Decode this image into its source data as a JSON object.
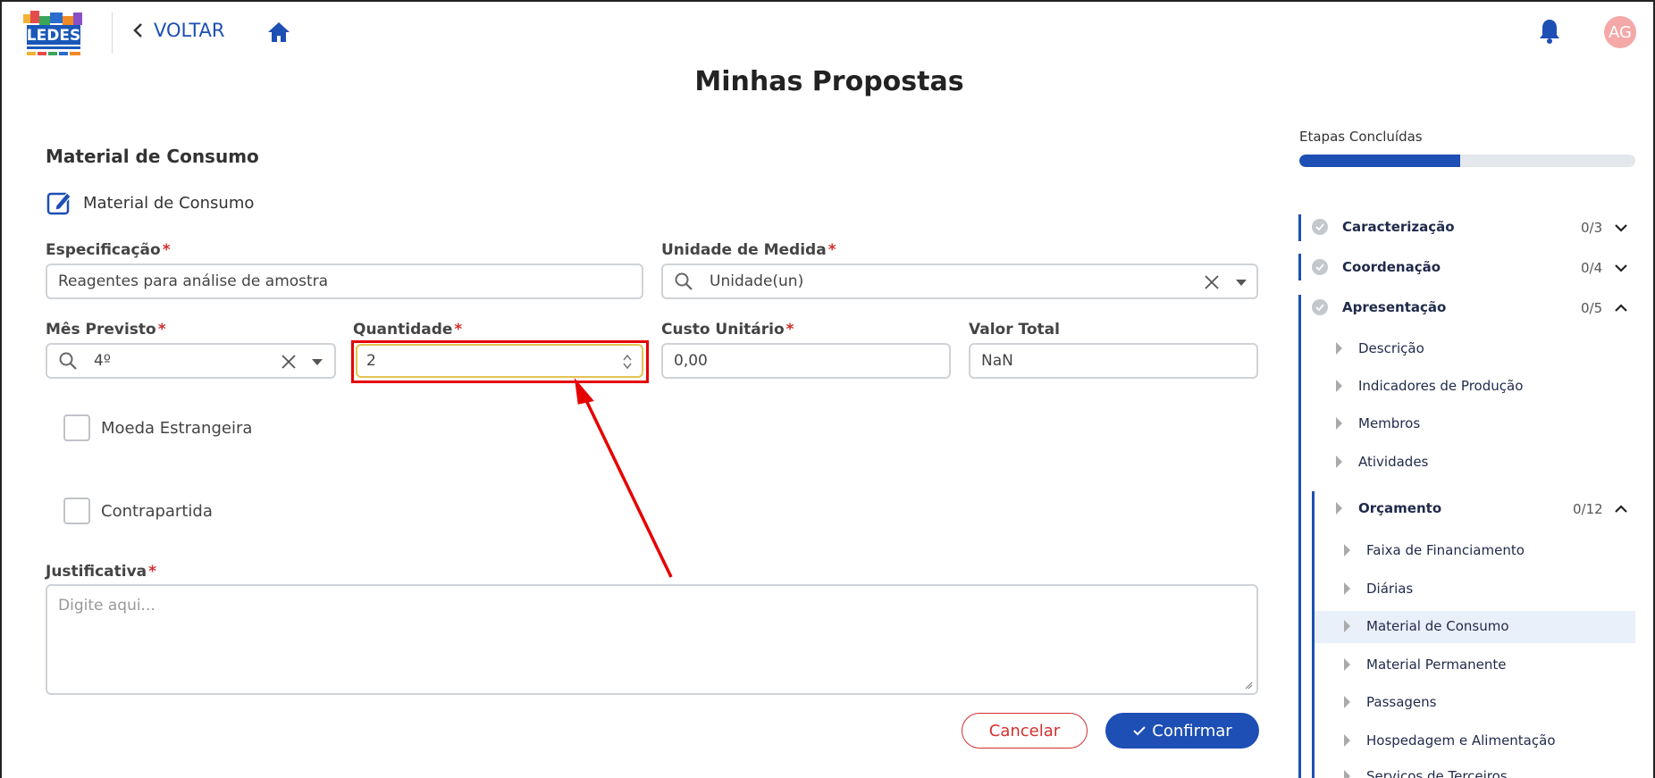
{
  "header": {
    "back_label": "VOLTAR",
    "avatar_initials": "AG",
    "page_title": "Minhas Propostas"
  },
  "form": {
    "section_title": "Material de Consumo",
    "edit_label": "Material de Consumo",
    "especificacao": {
      "label": "Especificação",
      "required": "*",
      "value": "Reagentes para análise de amostra"
    },
    "unidade": {
      "label": "Unidade de Medida",
      "required": "*",
      "value": "Unidade(un)"
    },
    "mes": {
      "label": "Mês Previsto",
      "required": "*",
      "value": "4º"
    },
    "quantidade": {
      "label": "Quantidade",
      "required": "*",
      "value": "2"
    },
    "custo": {
      "label": "Custo Unitário",
      "required": "*",
      "value": "0,00"
    },
    "valor_total": {
      "label": "Valor Total",
      "value": "NaN"
    },
    "moeda_label": "Moeda Estrangeira",
    "contrapartida_label": "Contrapartida",
    "justificativa": {
      "label": "Justificativa",
      "required": "*",
      "placeholder": "Digite aqui..."
    },
    "cancel_label": "Cancelar",
    "confirm_label": "Confirmar"
  },
  "sidebar": {
    "title": "Etapas Concluídas",
    "progress_percent": 48,
    "sections": [
      {
        "label": "Caracterização",
        "count": "0/3"
      },
      {
        "label": "Coordenação",
        "count": "0/4"
      },
      {
        "label": "Apresentação",
        "count": "0/5"
      }
    ],
    "apresentacao_items": [
      "Descrição",
      "Indicadores de Produção",
      "Membros",
      "Atividades"
    ],
    "orcamento": {
      "label": "Orçamento",
      "count": "0/12"
    },
    "orcamento_items": [
      "Faixa de Financiamento",
      "Diárias",
      "Material de Consumo",
      "Material Permanente",
      "Passagens",
      "Hospedagem e Alimentação",
      "Serviços de Terceiros"
    ]
  },
  "colors": {
    "primary": "#1d4fb4",
    "required": "#d32f2f",
    "highlight": "#e60000"
  }
}
